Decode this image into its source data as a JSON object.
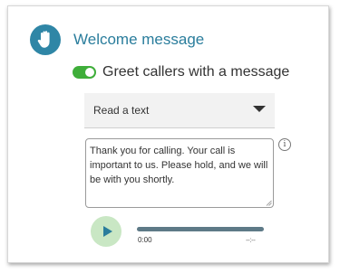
{
  "header": {
    "title": "Welcome message",
    "icon": "hand-wave-icon",
    "icon_bg_color": "#2f86a6",
    "title_color": "#2a7d9c"
  },
  "greeting_toggle": {
    "label": "Greet callers with a message",
    "enabled": true,
    "on_color": "#3fae3a"
  },
  "message_source": {
    "selected": "Read a text"
  },
  "message_text": {
    "value": "Thank you for calling. Your call is important to us. Please hold, and we will be with you shortly."
  },
  "info": {
    "icon": "info-icon",
    "glyph": "i"
  },
  "player": {
    "play_icon": "play-icon",
    "current_time": "0:00",
    "total_time": "--:--",
    "progress": 0
  }
}
